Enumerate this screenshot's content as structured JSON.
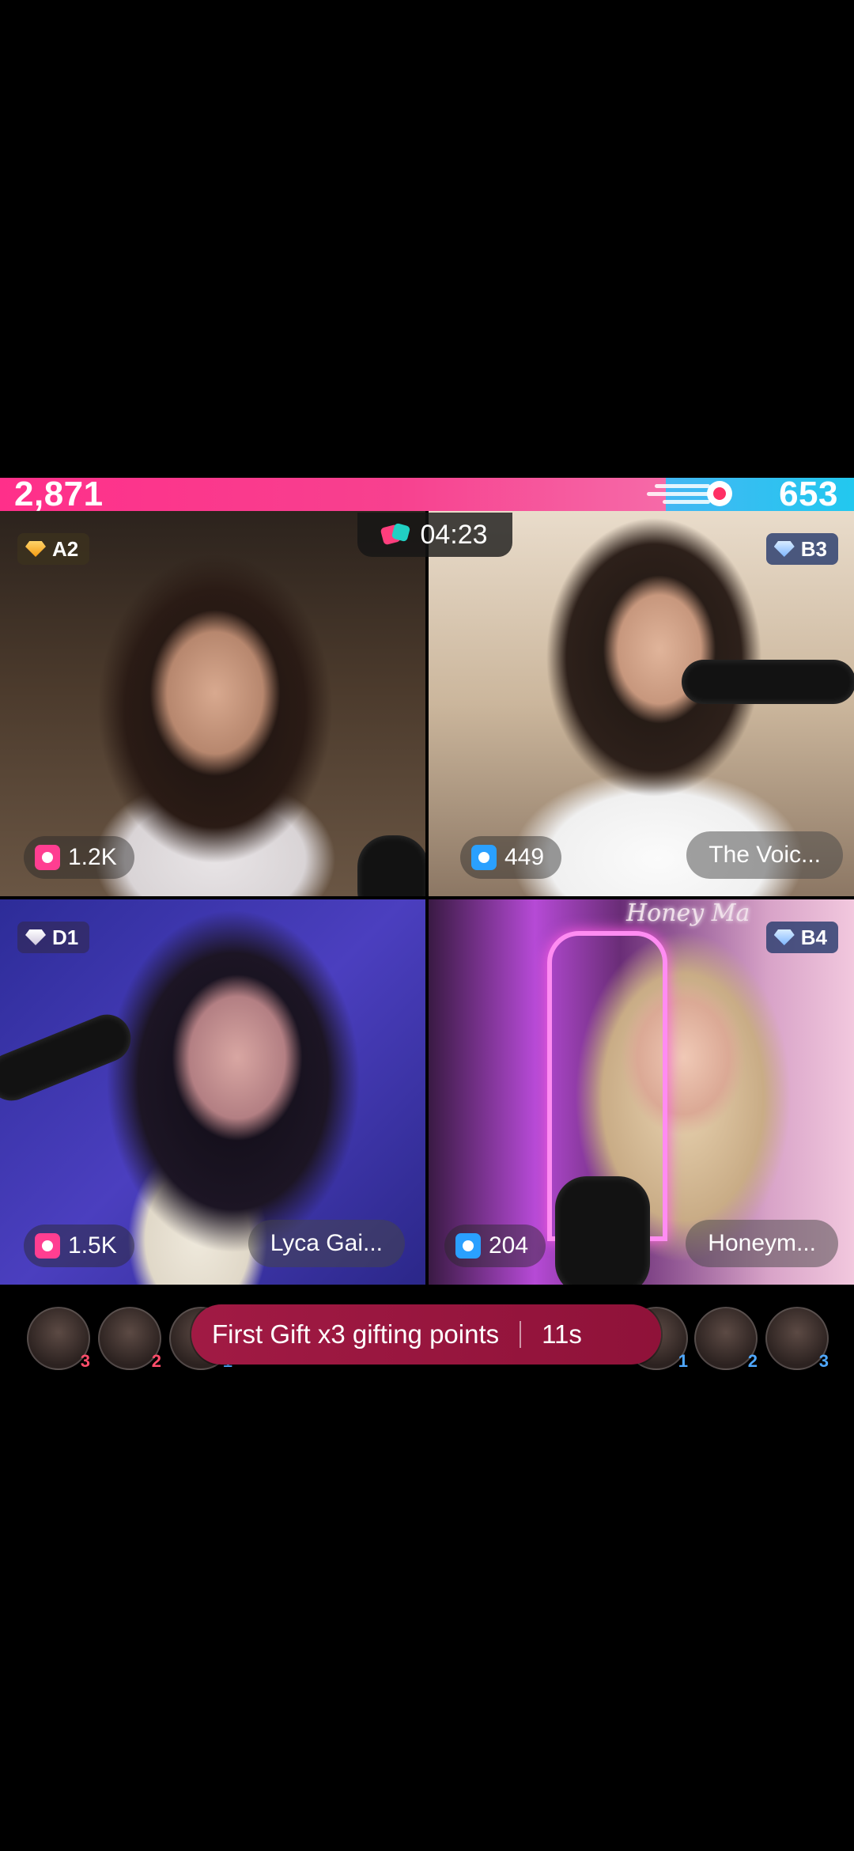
{
  "battle": {
    "left_score": "2,871",
    "right_score": "653",
    "timer": "04:23",
    "colors": {
      "left": "#ff2f8a",
      "right": "#22c8ef"
    }
  },
  "tiles": [
    {
      "id": "a2",
      "rank": "A2",
      "gem": "gold",
      "score": "1.2K",
      "score_color": "pink",
      "name": ""
    },
    {
      "id": "b3",
      "rank": "B3",
      "gem": "blue",
      "score": "449",
      "score_color": "blue",
      "name": "The Voic..."
    },
    {
      "id": "d1",
      "rank": "D1",
      "gem": "plain",
      "score": "1.5K",
      "score_color": "pink",
      "name": "Lyca Gai..."
    },
    {
      "id": "b4",
      "rank": "B4",
      "gem": "blue",
      "score": "204",
      "score_color": "blue",
      "name": "Honeym..."
    }
  ],
  "decor": {
    "sign_text": "Honey Ma"
  },
  "strip": {
    "avatars": [
      {
        "rank": "3",
        "team": "red"
      },
      {
        "rank": "2",
        "team": "red"
      },
      {
        "rank": "1",
        "team": "blue"
      },
      {
        "rank": "1",
        "team": "blue"
      },
      {
        "rank": "2",
        "team": "blue"
      },
      {
        "rank": "3",
        "team": "blue"
      }
    ],
    "banner_text": "First Gift x3 gifting points",
    "banner_countdown": "11s"
  }
}
